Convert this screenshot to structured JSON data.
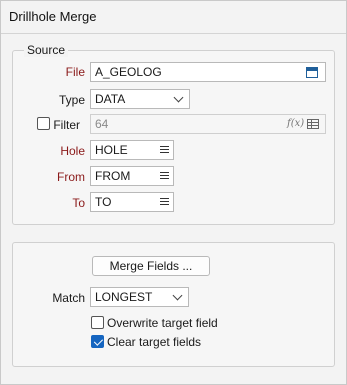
{
  "window": {
    "title": "Drillhole Merge"
  },
  "source": {
    "legend": "Source",
    "file": {
      "label": "File",
      "value": "A_GEOLOG"
    },
    "type": {
      "label": "Type",
      "value": "DATA"
    },
    "filter": {
      "label": "Filter",
      "value": "64",
      "checked": false,
      "fx_label": "f(x)"
    },
    "hole": {
      "label": "Hole",
      "value": "HOLE"
    },
    "from": {
      "label": "From",
      "value": "FROM"
    },
    "to": {
      "label": "To",
      "value": "TO"
    }
  },
  "merge": {
    "merge_fields_label": "Merge Fields ...",
    "match": {
      "label": "Match",
      "value": "LONGEST"
    },
    "overwrite": {
      "label": "Overwrite target field",
      "checked": false
    },
    "clear": {
      "label": "Clear target fields",
      "checked": true
    }
  },
  "colors": {
    "required_label": "#8b1a1a",
    "accent": "#1565c0"
  },
  "icons": {
    "file_browse": "calendar-icon",
    "field_list": "list-icon",
    "dropdown": "chevron-down-icon",
    "expression": "fx-icon",
    "table": "table-icon"
  }
}
